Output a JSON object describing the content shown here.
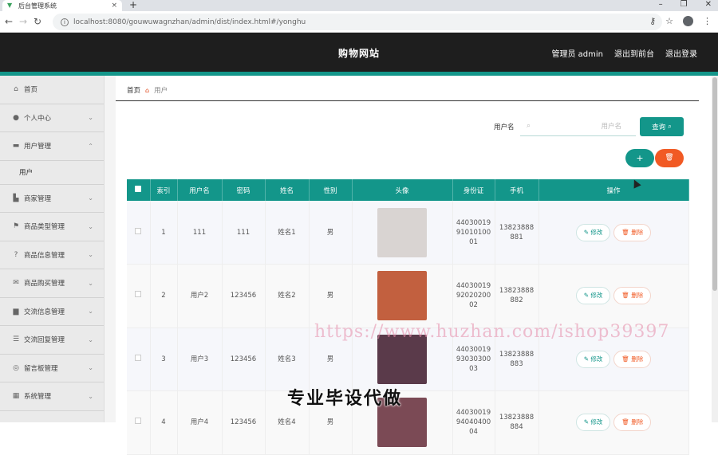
{
  "browser": {
    "tab_title": "后台管理系统",
    "url": "localhost:8080/gouwuwagnzhan/admin/dist/index.html#/yonghu"
  },
  "header": {
    "title": "购物网站",
    "admin_label": "管理员 admin",
    "back_to_front": "退出到前台",
    "logout": "退出登录"
  },
  "sidebar": {
    "items": [
      {
        "label": "首页",
        "icon": "home-icon",
        "expandable": false
      },
      {
        "label": "个人中心",
        "icon": "user-icon",
        "expandable": true
      },
      {
        "label": "用户管理",
        "icon": "users-icon",
        "expandable": true,
        "open": true
      },
      {
        "label": "商家管理",
        "icon": "shop-icon",
        "expandable": true
      },
      {
        "label": "商品类型管理",
        "icon": "flag-icon",
        "expandable": true
      },
      {
        "label": "商品信息管理",
        "icon": "help-icon",
        "expandable": true
      },
      {
        "label": "商品购买管理",
        "icon": "mail-icon",
        "expandable": true
      },
      {
        "label": "交流信息管理",
        "icon": "chat-icon",
        "expandable": true
      },
      {
        "label": "交流回复管理",
        "icon": "sliders-icon",
        "expandable": true
      },
      {
        "label": "留言板管理",
        "icon": "globe-icon",
        "expandable": true
      },
      {
        "label": "系统管理",
        "icon": "grid-icon",
        "expandable": true
      }
    ],
    "sub_item": "用户"
  },
  "breadcrumb": {
    "home": "首页",
    "current": "用户"
  },
  "search": {
    "label": "用户名",
    "placeholder": "用户名",
    "button": "查询"
  },
  "actions": {
    "add": "+",
    "delete": "🗑"
  },
  "table": {
    "headers": [
      "索引",
      "用户名",
      "密码",
      "姓名",
      "性别",
      "头像",
      "身份证",
      "手机",
      "操作"
    ],
    "edit_label": "修改",
    "delete_label": "删除",
    "rows": [
      {
        "index": "1",
        "username": "111",
        "password": "111",
        "name": "姓名1",
        "gender": "男",
        "id_card": "44030019 91010100 01",
        "phone": "13823888 881",
        "photo_color": "#d9d4d2"
      },
      {
        "index": "2",
        "username": "用户2",
        "password": "123456",
        "name": "姓名2",
        "gender": "男",
        "id_card": "44030019 92020200 02",
        "phone": "13823888 882",
        "photo_color": "#c2603f"
      },
      {
        "index": "3",
        "username": "用户3",
        "password": "123456",
        "name": "姓名3",
        "gender": "男",
        "id_card": "44030019 93030300 03",
        "phone": "13823888 883",
        "photo_color": "#5a3a4a"
      },
      {
        "index": "4",
        "username": "用户4",
        "password": "123456",
        "name": "姓名4",
        "gender": "男",
        "id_card": "44030019 94040400 04",
        "phone": "13823888 884",
        "photo_color": "#7b4a55"
      }
    ]
  },
  "overlay": {
    "watermark": "https://www.huzhan.com/ishop39397",
    "caption": "专业毕设代做"
  },
  "colors": {
    "accent": "#13968a",
    "danger": "#f15a24",
    "header_bg": "#1e1e1e",
    "sidebar_bg": "#eaeaea"
  }
}
